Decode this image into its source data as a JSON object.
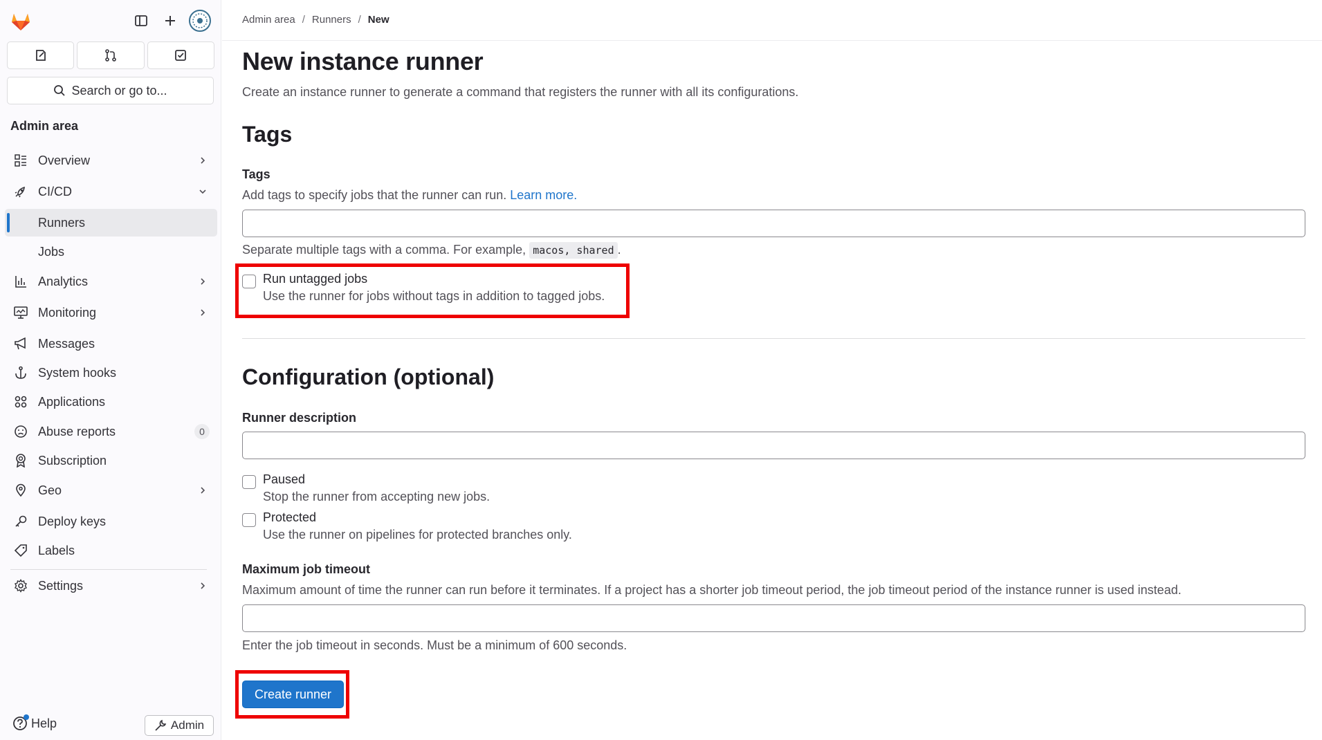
{
  "sidebar": {
    "quick_actions": [
      "issues-icon",
      "merge-requests-icon",
      "todos-icon"
    ],
    "search_label": "Search or go to...",
    "section_title": "Admin area",
    "items": [
      {
        "label": "Overview",
        "icon": "overview-icon",
        "chevron": "right"
      },
      {
        "label": "CI/CD",
        "icon": "rocket-icon",
        "chevron": "down"
      },
      {
        "label": "Runners",
        "icon": "",
        "active": true
      },
      {
        "label": "Jobs",
        "icon": ""
      },
      {
        "label": "Analytics",
        "icon": "chart-icon",
        "chevron": "right"
      },
      {
        "label": "Monitoring",
        "icon": "monitor-icon",
        "chevron": "right"
      },
      {
        "label": "Messages",
        "icon": "megaphone-icon"
      },
      {
        "label": "System hooks",
        "icon": "anchor-icon"
      },
      {
        "label": "Applications",
        "icon": "apps-icon"
      },
      {
        "label": "Abuse reports",
        "icon": "sad-face-icon",
        "badge": "0"
      },
      {
        "label": "Subscription",
        "icon": "award-icon"
      },
      {
        "label": "Geo",
        "icon": "location-icon",
        "chevron": "right"
      },
      {
        "label": "Deploy keys",
        "icon": "key-icon"
      },
      {
        "label": "Labels",
        "icon": "label-icon"
      },
      {
        "label": "Settings",
        "icon": "gear-icon",
        "chevron": "right"
      }
    ],
    "help_label": "Help",
    "admin_label": "Admin"
  },
  "breadcrumb": {
    "items": [
      "Admin area",
      "Runners",
      "New"
    ],
    "separator": "/"
  },
  "page": {
    "title": "New instance runner",
    "description": "Create an instance runner to generate a command that registers the runner with all its configurations."
  },
  "tags_section": {
    "heading": "Tags",
    "label": "Tags",
    "help_prefix": "Add tags to specify jobs that the runner can run.",
    "help_link": "Learn more.",
    "input_value": "",
    "hint_prefix": "Separate multiple tags with a comma. For example,",
    "hint_code": "macos, shared",
    "hint_suffix": ".",
    "run_untagged": {
      "label": "Run untagged jobs",
      "help": "Use the runner for jobs without tags in addition to tagged jobs.",
      "checked": false
    }
  },
  "config_section": {
    "heading": "Configuration (optional)",
    "description_label": "Runner description",
    "description_value": "",
    "paused": {
      "label": "Paused",
      "help": "Stop the runner from accepting new jobs.",
      "checked": false
    },
    "protected": {
      "label": "Protected",
      "help": "Use the runner on pipelines for protected branches only.",
      "checked": false
    },
    "timeout_label": "Maximum job timeout",
    "timeout_help": "Maximum amount of time the runner can run before it terminates. If a project has a shorter job timeout period, the job timeout period of the instance runner is used instead.",
    "timeout_value": "",
    "timeout_hint": "Enter the job timeout in seconds. Must be a minimum of 600 seconds."
  },
  "actions": {
    "create_label": "Create runner"
  },
  "colors": {
    "accent": "#1f75cb",
    "highlight": "#ee0000",
    "logo_orange": "#fc6d26"
  }
}
